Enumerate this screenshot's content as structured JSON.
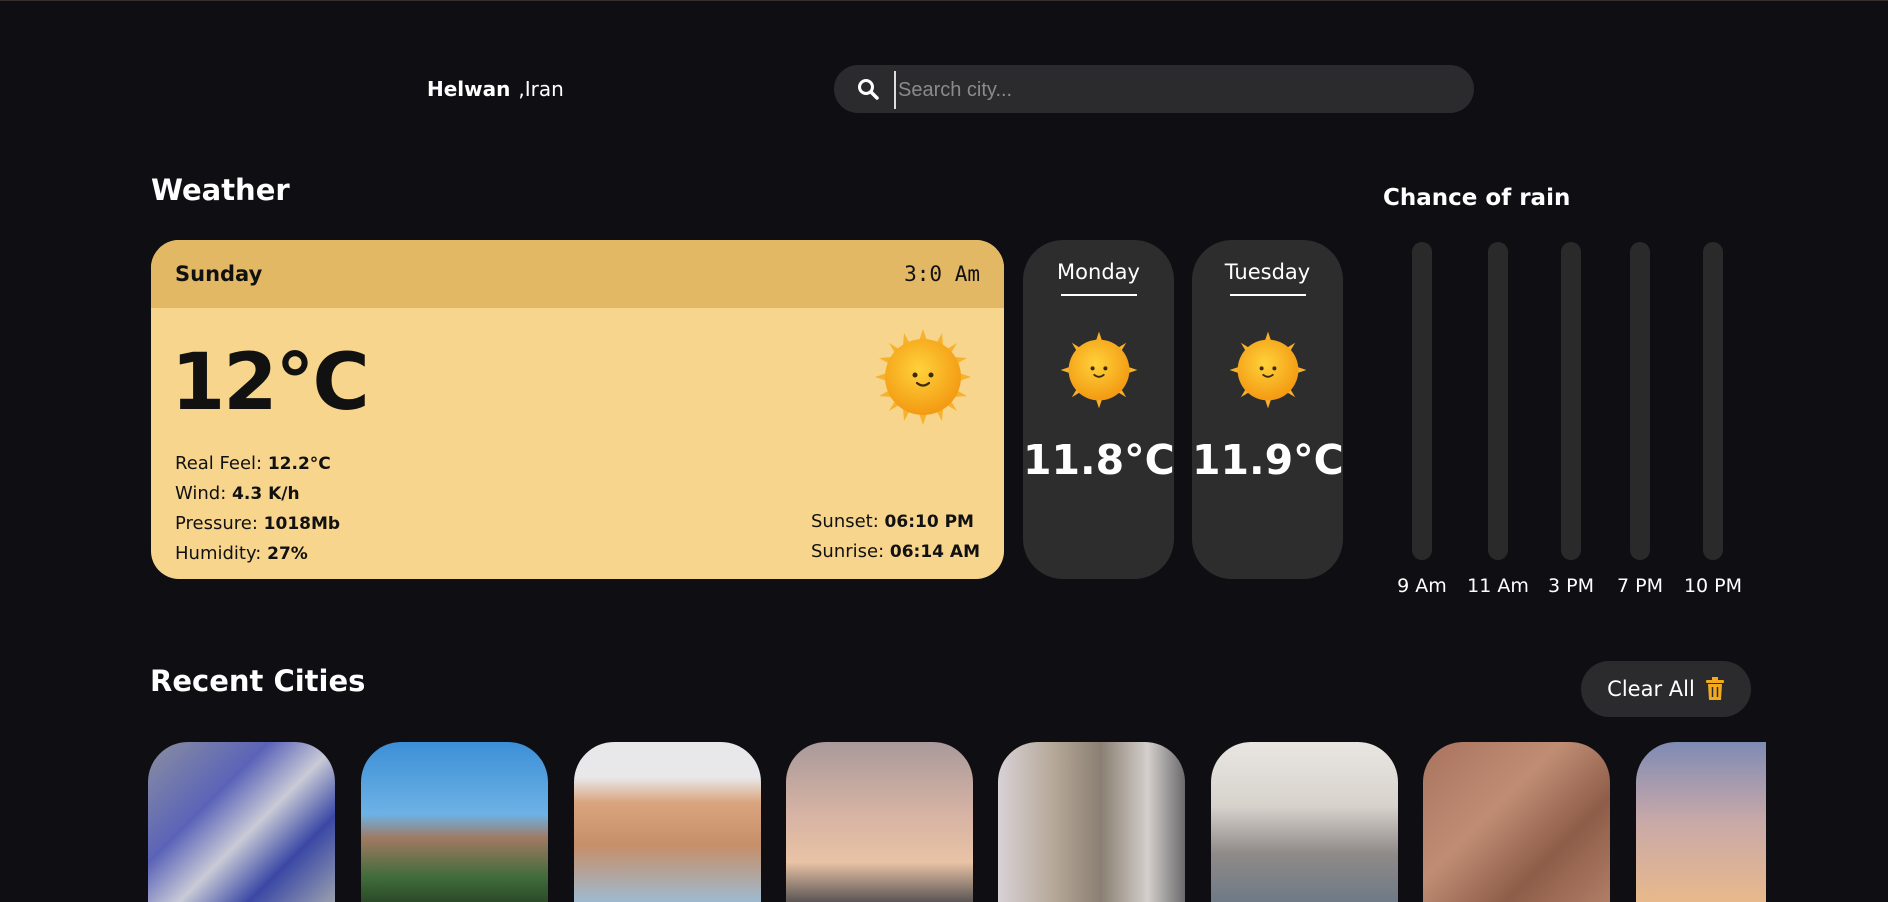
{
  "header": {
    "city": "Helwan",
    "country": ",Iran",
    "search_placeholder": "Search city..."
  },
  "weather": {
    "title": "Weather",
    "today": {
      "day": "Sunday",
      "time": "3:0 Am",
      "temperature": "12°C",
      "real_feel_label": "Real Feel:",
      "real_feel": "12.2°C",
      "wind_label": "Wind:",
      "wind": "4.3 K/h",
      "pressure_label": "Pressure:",
      "pressure": "1018Mb",
      "humidity_label": "Humidity:",
      "humidity": "27%",
      "sunset_label": "Sunset:",
      "sunset": "06:10 PM",
      "sunrise_label": "Sunrise:",
      "sunrise": "06:14 AM",
      "icon": "sun-icon"
    },
    "forecast": [
      {
        "day": "Monday",
        "temperature": "11.8°C",
        "icon": "sun-icon"
      },
      {
        "day": "Tuesday",
        "temperature": "11.9°C",
        "icon": "sun-icon"
      }
    ]
  },
  "rain": {
    "title": "Chance of rain",
    "hours": [
      "9 Am",
      "11 Am",
      "3 PM",
      "7 PM",
      "10 PM"
    ]
  },
  "recent": {
    "title": "Recent Cities",
    "clear_label": "Clear All",
    "clear_icon": "trash-icon",
    "cities_count_visible": 8
  },
  "colors": {
    "background": "#0f0f13",
    "card_today": "#f7d58c",
    "card_today_header": "#e2b865",
    "card_dark": "#2d2d2e",
    "accent": "#f2a91e"
  }
}
